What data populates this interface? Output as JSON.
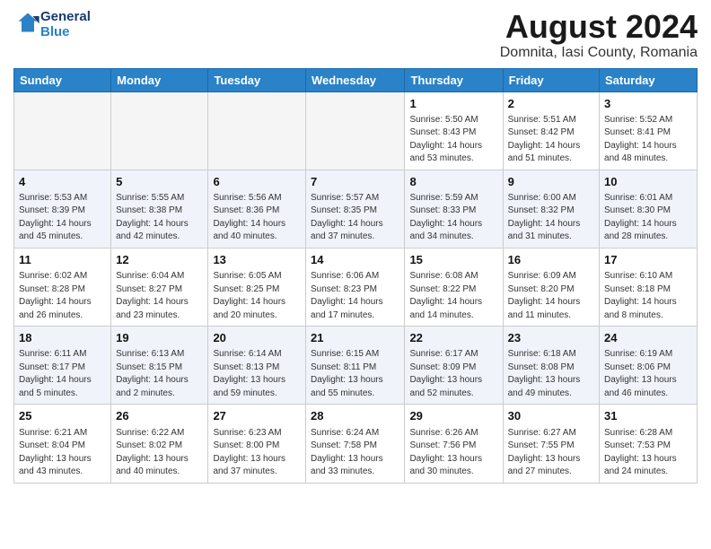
{
  "header": {
    "logo_line1": "General",
    "logo_line2": "Blue",
    "month_year": "August 2024",
    "location": "Domnita, Iasi County, Romania"
  },
  "weekdays": [
    "Sunday",
    "Monday",
    "Tuesday",
    "Wednesday",
    "Thursday",
    "Friday",
    "Saturday"
  ],
  "weeks": [
    [
      {
        "day": "",
        "info": ""
      },
      {
        "day": "",
        "info": ""
      },
      {
        "day": "",
        "info": ""
      },
      {
        "day": "",
        "info": ""
      },
      {
        "day": "1",
        "info": "Sunrise: 5:50 AM\nSunset: 8:43 PM\nDaylight: 14 hours\nand 53 minutes."
      },
      {
        "day": "2",
        "info": "Sunrise: 5:51 AM\nSunset: 8:42 PM\nDaylight: 14 hours\nand 51 minutes."
      },
      {
        "day": "3",
        "info": "Sunrise: 5:52 AM\nSunset: 8:41 PM\nDaylight: 14 hours\nand 48 minutes."
      }
    ],
    [
      {
        "day": "4",
        "info": "Sunrise: 5:53 AM\nSunset: 8:39 PM\nDaylight: 14 hours\nand 45 minutes."
      },
      {
        "day": "5",
        "info": "Sunrise: 5:55 AM\nSunset: 8:38 PM\nDaylight: 14 hours\nand 42 minutes."
      },
      {
        "day": "6",
        "info": "Sunrise: 5:56 AM\nSunset: 8:36 PM\nDaylight: 14 hours\nand 40 minutes."
      },
      {
        "day": "7",
        "info": "Sunrise: 5:57 AM\nSunset: 8:35 PM\nDaylight: 14 hours\nand 37 minutes."
      },
      {
        "day": "8",
        "info": "Sunrise: 5:59 AM\nSunset: 8:33 PM\nDaylight: 14 hours\nand 34 minutes."
      },
      {
        "day": "9",
        "info": "Sunrise: 6:00 AM\nSunset: 8:32 PM\nDaylight: 14 hours\nand 31 minutes."
      },
      {
        "day": "10",
        "info": "Sunrise: 6:01 AM\nSunset: 8:30 PM\nDaylight: 14 hours\nand 28 minutes."
      }
    ],
    [
      {
        "day": "11",
        "info": "Sunrise: 6:02 AM\nSunset: 8:28 PM\nDaylight: 14 hours\nand 26 minutes."
      },
      {
        "day": "12",
        "info": "Sunrise: 6:04 AM\nSunset: 8:27 PM\nDaylight: 14 hours\nand 23 minutes."
      },
      {
        "day": "13",
        "info": "Sunrise: 6:05 AM\nSunset: 8:25 PM\nDaylight: 14 hours\nand 20 minutes."
      },
      {
        "day": "14",
        "info": "Sunrise: 6:06 AM\nSunset: 8:23 PM\nDaylight: 14 hours\nand 17 minutes."
      },
      {
        "day": "15",
        "info": "Sunrise: 6:08 AM\nSunset: 8:22 PM\nDaylight: 14 hours\nand 14 minutes."
      },
      {
        "day": "16",
        "info": "Sunrise: 6:09 AM\nSunset: 8:20 PM\nDaylight: 14 hours\nand 11 minutes."
      },
      {
        "day": "17",
        "info": "Sunrise: 6:10 AM\nSunset: 8:18 PM\nDaylight: 14 hours\nand 8 minutes."
      }
    ],
    [
      {
        "day": "18",
        "info": "Sunrise: 6:11 AM\nSunset: 8:17 PM\nDaylight: 14 hours\nand 5 minutes."
      },
      {
        "day": "19",
        "info": "Sunrise: 6:13 AM\nSunset: 8:15 PM\nDaylight: 14 hours\nand 2 minutes."
      },
      {
        "day": "20",
        "info": "Sunrise: 6:14 AM\nSunset: 8:13 PM\nDaylight: 13 hours\nand 59 minutes."
      },
      {
        "day": "21",
        "info": "Sunrise: 6:15 AM\nSunset: 8:11 PM\nDaylight: 13 hours\nand 55 minutes."
      },
      {
        "day": "22",
        "info": "Sunrise: 6:17 AM\nSunset: 8:09 PM\nDaylight: 13 hours\nand 52 minutes."
      },
      {
        "day": "23",
        "info": "Sunrise: 6:18 AM\nSunset: 8:08 PM\nDaylight: 13 hours\nand 49 minutes."
      },
      {
        "day": "24",
        "info": "Sunrise: 6:19 AM\nSunset: 8:06 PM\nDaylight: 13 hours\nand 46 minutes."
      }
    ],
    [
      {
        "day": "25",
        "info": "Sunrise: 6:21 AM\nSunset: 8:04 PM\nDaylight: 13 hours\nand 43 minutes."
      },
      {
        "day": "26",
        "info": "Sunrise: 6:22 AM\nSunset: 8:02 PM\nDaylight: 13 hours\nand 40 minutes."
      },
      {
        "day": "27",
        "info": "Sunrise: 6:23 AM\nSunset: 8:00 PM\nDaylight: 13 hours\nand 37 minutes."
      },
      {
        "day": "28",
        "info": "Sunrise: 6:24 AM\nSunset: 7:58 PM\nDaylight: 13 hours\nand 33 minutes."
      },
      {
        "day": "29",
        "info": "Sunrise: 6:26 AM\nSunset: 7:56 PM\nDaylight: 13 hours\nand 30 minutes."
      },
      {
        "day": "30",
        "info": "Sunrise: 6:27 AM\nSunset: 7:55 PM\nDaylight: 13 hours\nand 27 minutes."
      },
      {
        "day": "31",
        "info": "Sunrise: 6:28 AM\nSunset: 7:53 PM\nDaylight: 13 hours\nand 24 minutes."
      }
    ]
  ]
}
